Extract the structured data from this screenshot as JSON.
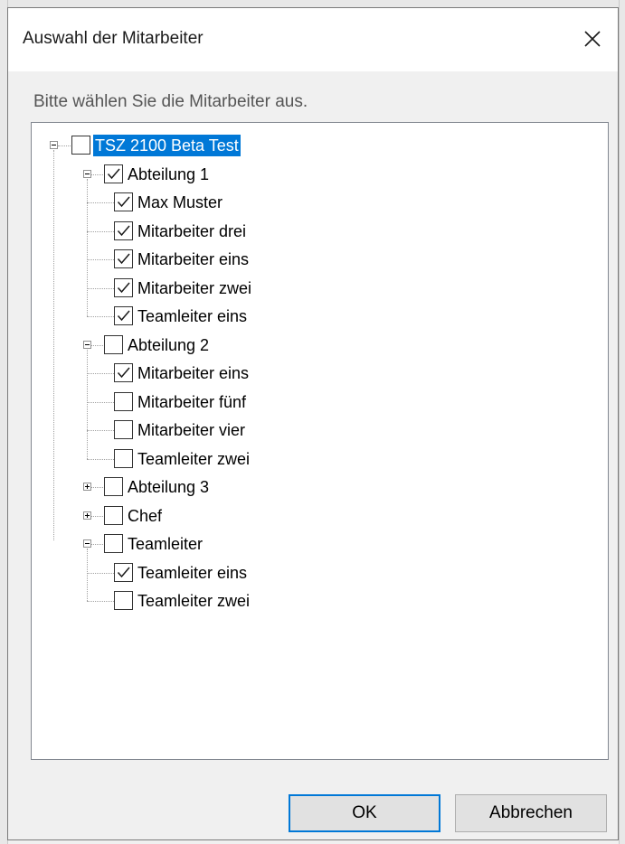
{
  "dialog": {
    "title": "Auswahl der Mitarbeiter",
    "prompt": "Bitte wählen Sie die Mitarbeiter aus.",
    "close_icon": "close-icon"
  },
  "tree": {
    "root": {
      "label": "TSZ 2100 Beta Test",
      "checked": false,
      "selected": true,
      "expanded": true
    },
    "groups": [
      {
        "label": "Abteilung 1",
        "checked": true,
        "expanded": true,
        "children": [
          {
            "label": "Max Muster",
            "checked": true
          },
          {
            "label": "Mitarbeiter drei",
            "checked": true
          },
          {
            "label": "Mitarbeiter eins",
            "checked": true
          },
          {
            "label": "Mitarbeiter zwei",
            "checked": true
          },
          {
            "label": "Teamleiter eins",
            "checked": true
          }
        ]
      },
      {
        "label": "Abteilung 2",
        "checked": false,
        "expanded": true,
        "children": [
          {
            "label": "Mitarbeiter eins",
            "checked": true
          },
          {
            "label": "Mitarbeiter fünf",
            "checked": false
          },
          {
            "label": "Mitarbeiter vier",
            "checked": false
          },
          {
            "label": "Teamleiter zwei",
            "checked": false
          }
        ]
      },
      {
        "label": "Abteilung 3",
        "checked": false,
        "expanded": false,
        "children": []
      },
      {
        "label": "Chef",
        "checked": false,
        "expanded": false,
        "children": []
      },
      {
        "label": "Teamleiter",
        "checked": false,
        "expanded": true,
        "children": [
          {
            "label": "Teamleiter eins",
            "checked": true
          },
          {
            "label": "Teamleiter zwei",
            "checked": false
          }
        ]
      }
    ]
  },
  "buttons": {
    "ok": "OK",
    "cancel": "Abbrechen"
  },
  "colors": {
    "selection": "#0078d7",
    "tree_border": "#828790",
    "dialog_bg": "#f0f0f0"
  }
}
